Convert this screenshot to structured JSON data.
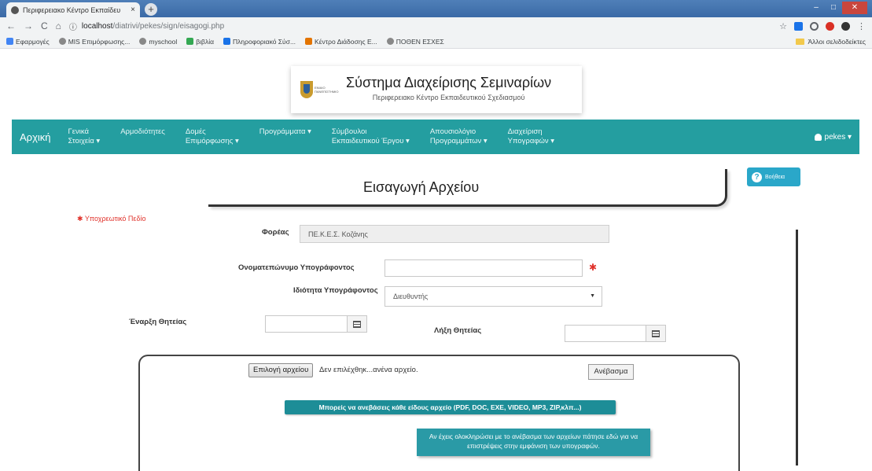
{
  "browser": {
    "tab_title": "Περιφερειακο Κέντρο Εκπαίδευ",
    "tab_close": "×",
    "new_tab": "+",
    "url_host": "localhost",
    "url_path": "/diatrivi/pekes/sign/eisagogi.php",
    "bookmarks": [
      "Εφαρμογές",
      "MIS Επιμόρφωσης...",
      "myschool",
      "βιβλία",
      "Πληροφοριακό Σύσ...",
      "Κέντρο Διάδοσης Ε...",
      "ΠΟΘΕΝ ΕΣΧΕΣ"
    ],
    "other_bookmarks": "Άλλοι σελιδοδείκτες"
  },
  "header": {
    "system_title": "Σύστημα Διαχείρισης Σεμιναρίων",
    "subtitle": "Περιφερειακο Κέντρο Εκπαιδευτικού Σχεδιασμού",
    "logo_text": "ΕΝΙΑΙΟ ΠΑΝΕΠΙΣΤΗΜΙΟ"
  },
  "nav": {
    "brand": "Αρχική",
    "items": [
      {
        "line1": "Γενικά",
        "line2": "Στοιχεία ▾"
      },
      {
        "line1": "Αρμοδιότητες",
        "line2": ""
      },
      {
        "line1": "Δομές",
        "line2": "Επιμόρφωσης ▾"
      },
      {
        "line1": "Προγράμματα ▾",
        "line2": ""
      },
      {
        "line1": "Σύμβουλοι",
        "line2": "Εκπαιδευτικού Έργου ▾"
      },
      {
        "line1": "Απουσιολόγιο",
        "line2": "Προγραμμάτων ▾"
      },
      {
        "line1": "Διαχείριση",
        "line2": "Υπογραφών ▾"
      }
    ],
    "user": "pekes ▾"
  },
  "page": {
    "title": "Εισαγωγή Αρχείου",
    "help": "Βοήθεια",
    "required_note": "✱ Υποχρεωτικό Πεδίο"
  },
  "form": {
    "foreas_label": "Φορέας",
    "foreas_value": "ΠΕ.Κ.Ε.Σ. Κοζάνης",
    "name_label": "Ονοματεπώνυμο Υπογράφοντος",
    "name_value": "",
    "role_label": "Ιδιότητα Υπογράφοντος",
    "role_value": "Διευθυντής",
    "start_label": "Έναρξη Θητείας",
    "end_label": "Λήξη Θητείας",
    "required_mark": "✱"
  },
  "upload": {
    "choose_label": "Επιλογή αρχείου",
    "no_file": "Δεν επιλέχθηκ...ανένα αρχείο.",
    "upload_label": "Ανέβασμα",
    "note": "Μπορείς να ανεβάσεις κάθε είδους αρχείο (PDF, DOC, EXE, VIDEO, MP3, ZIP,κλπ...)",
    "done_msg": "Αν έχεις ολοκληρώσει με το ανέβασμα των αρχείων πάτησε εδώ για να επιστρέψεις στην εμφάνιση των υπογραφών."
  }
}
